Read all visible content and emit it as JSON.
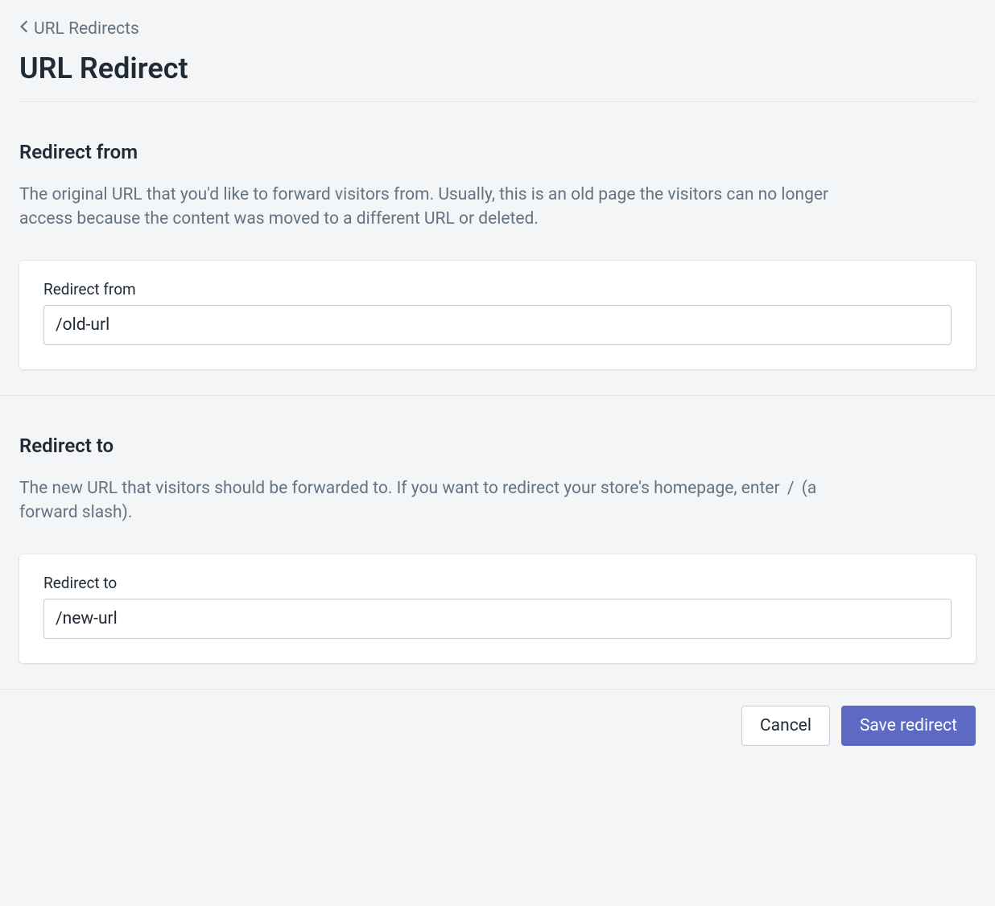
{
  "breadcrumb": {
    "label": "URL Redirects"
  },
  "page": {
    "title": "URL Redirect"
  },
  "sections": {
    "from": {
      "heading": "Redirect from",
      "description": "The original URL that you'd like to forward visitors from. Usually, this is an old page the visitors can no longer access because the content was moved to a different URL or deleted.",
      "field_label": "Redirect from",
      "field_value": "/old-url"
    },
    "to": {
      "heading": "Redirect to",
      "description_pre": "The new URL that visitors should be forwarded to. If you want to redirect your store's homepage, enter ",
      "description_code": "/",
      "description_post": " (a forward slash).",
      "field_label": "Redirect to",
      "field_value": "/new-url"
    }
  },
  "footer": {
    "cancel_label": "Cancel",
    "save_label": "Save redirect"
  }
}
